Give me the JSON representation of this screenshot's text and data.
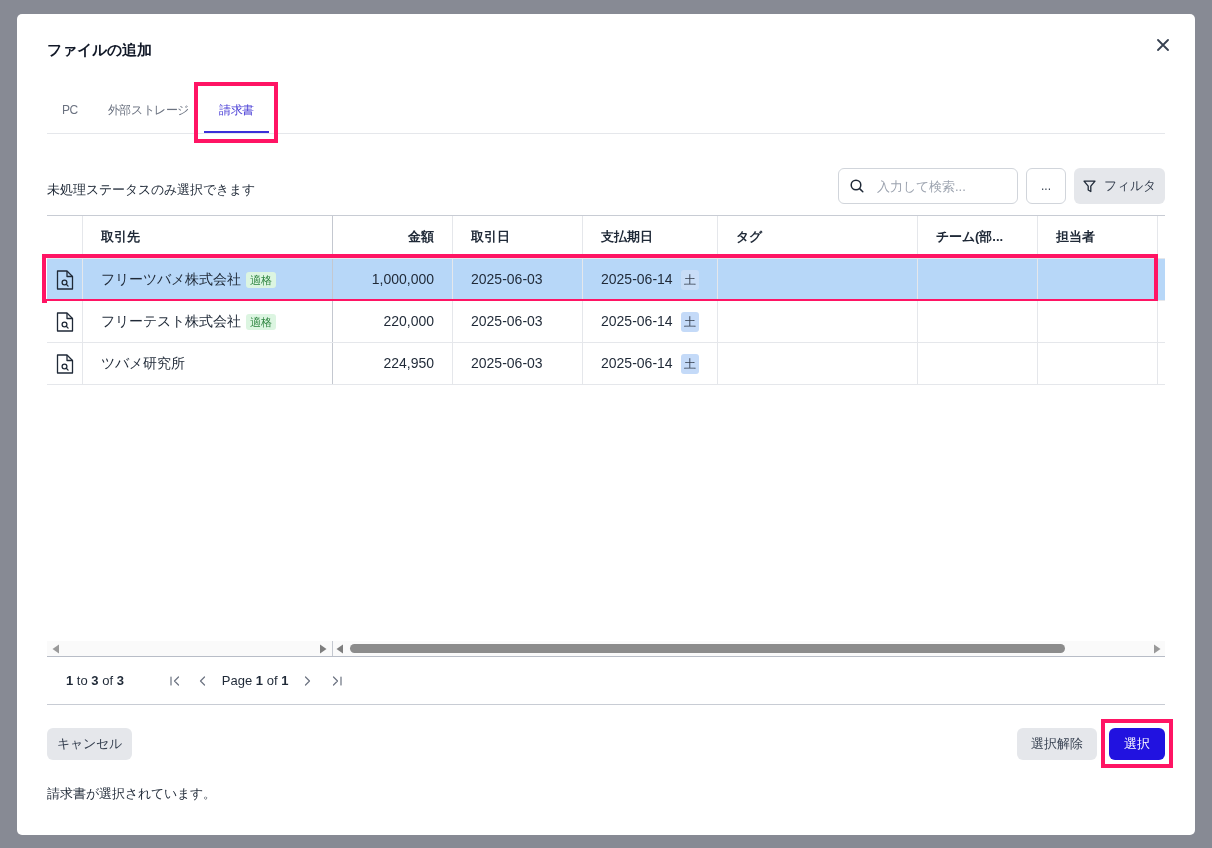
{
  "dialog": {
    "title": "ファイルの追加"
  },
  "tabs": [
    {
      "label": "PC",
      "selected": false,
      "annotated": false
    },
    {
      "label": "外部ストレージ",
      "selected": false,
      "annotated": false
    },
    {
      "label": "請求書",
      "selected": true,
      "annotated": true
    }
  ],
  "notice": "未処理ステータスのみ選択できます",
  "search": {
    "placeholder": "入力して検索..."
  },
  "more_button": "...",
  "filter_button": "フィルタ",
  "table": {
    "columns": [
      {
        "label": "取引先",
        "kind": "text"
      },
      {
        "label": "金額",
        "kind": "number"
      },
      {
        "label": "取引日",
        "kind": "text"
      },
      {
        "label": "支払期日",
        "kind": "text"
      },
      {
        "label": "タグ",
        "kind": "text"
      },
      {
        "label": "チーム(部...",
        "kind": "text"
      },
      {
        "label": "担当者",
        "kind": "text"
      }
    ],
    "rows": [
      {
        "partner": "フリーツバメ株式会社",
        "badge": "適格",
        "amount": "1,000,000",
        "date": "2025-06-03",
        "due_date": "2025-06-14",
        "weekday": "土",
        "selected": true,
        "annotated": true
      },
      {
        "partner": "フリーテスト株式会社",
        "badge": "適格",
        "amount": "220,000",
        "date": "2025-06-03",
        "due_date": "2025-06-14",
        "weekday": "土",
        "selected": false,
        "annotated": false
      },
      {
        "partner": "ツバメ研究所",
        "amount": "224,950",
        "date": "2025-06-03",
        "due_date": "2025-06-14",
        "weekday": "土",
        "selected": false,
        "annotated": false
      }
    ]
  },
  "pagination": {
    "summary": "**1** to **3** of **3**",
    "page": "Page **1** of **1**"
  },
  "footer": {
    "cancel": "キャンセル",
    "clear_selection": "選択解除",
    "select": {
      "label": "選択",
      "annotated": true
    }
  },
  "status_message": "請求書が選択されています。"
}
